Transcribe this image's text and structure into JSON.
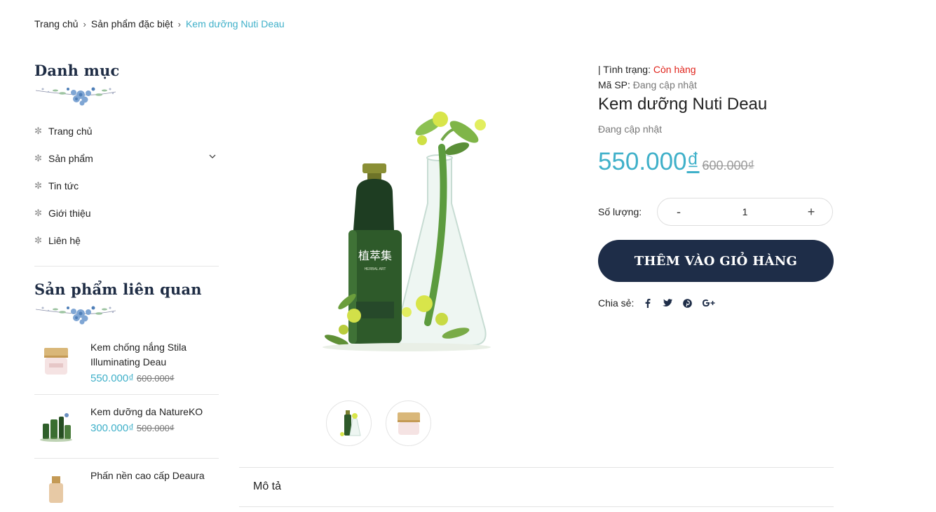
{
  "breadcrumb": {
    "home": "Trang chủ",
    "category": "Sản phẩm đặc biệt",
    "current": "Kem dưỡng Nuti Deau"
  },
  "sidebar": {
    "categories_title": "Danh mục",
    "categories": [
      {
        "label": "Trang chủ"
      },
      {
        "label": "Sản phẩm"
      },
      {
        "label": "Tin tức"
      },
      {
        "label": "Giới thiệu"
      },
      {
        "label": "Liên hệ"
      }
    ],
    "related_title": "Sản phẩm liên quan",
    "related": [
      {
        "name": "Kem chống nắng Stila Illuminating Deau",
        "price": "550.000₫",
        "old_price": "600.000₫"
      },
      {
        "name": "Kem dưỡng da NatureKO",
        "price": "300.000₫",
        "old_price": "500.000₫"
      },
      {
        "name": "Phấn nền cao cấp Deaura",
        "price": "",
        "old_price": ""
      }
    ]
  },
  "product": {
    "status_label": "| Tình trạng:",
    "status_value": "Còn hàng",
    "sku_label": "Mã SP:",
    "sku_value": "Đang cập nhật",
    "title": "Kem dưỡng Nuti Deau",
    "vendor": "Đang cập nhật",
    "price_number": "550.000",
    "price_currency": "₫",
    "old_price": "600.000₫",
    "quantity_label": "Số lượng:",
    "quantity_minus": "-",
    "quantity_value": "1",
    "quantity_plus": "+",
    "add_to_cart": "THÊM VÀO GIỎ HÀNG",
    "share_label": "Chia sẻ:",
    "share_icons": [
      "facebook-icon",
      "twitter-icon",
      "pinterest-icon",
      "google-plus-icon"
    ]
  },
  "tabs": {
    "description": "Mô tả"
  },
  "colors": {
    "accent": "#3fb0c9",
    "navy": "#1e2d48",
    "in_stock": "#e0231b"
  }
}
